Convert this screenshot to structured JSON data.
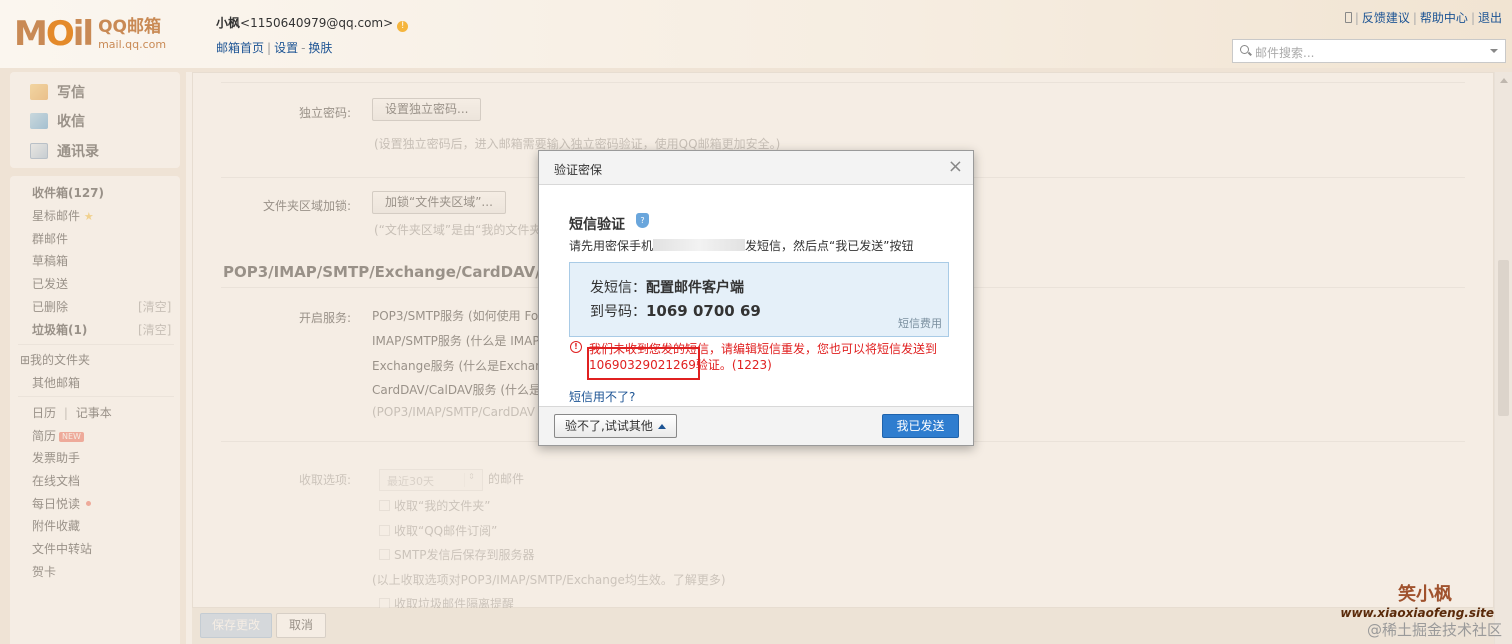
{
  "header": {
    "logo_mail": "M",
    "logo_o": "O",
    "logo_il": "il",
    "logo_cn": "QQ邮箱",
    "logo_url": "mail.qq.com",
    "user_name": "小枫",
    "user_email": "<1150640979@qq.com>",
    "warn_glyph": "!",
    "link_home": "邮箱首页",
    "link_settings": "设置",
    "link_skin": "换肤",
    "link_sep1": "|",
    "link_sep2": "-",
    "top_feedback": "反馈建议",
    "top_help": "帮助中心",
    "top_logout": "退出",
    "top_sep": "|",
    "search_placeholder": "邮件搜索..."
  },
  "sidebar": {
    "write": "写信",
    "receive": "收信",
    "contacts": "通讯录",
    "inbox": "收件箱(127)",
    "starred": "星标邮件",
    "star_glyph": "★",
    "group": "群邮件",
    "drafts": "草稿箱",
    "sent": "已发送",
    "deleted": "已删除",
    "clear": "[清空]",
    "spam": "垃圾箱(1)",
    "my_folders": "⊞我的文件夹",
    "other_mail": "其他邮箱",
    "calendar": "日历",
    "notes": "记事本",
    "cal_sep": "|",
    "resume": "简历",
    "new_badge": "NEW",
    "invoice": "发票助手",
    "docs": "在线文档",
    "daily": "每日悦读",
    "attachments": "附件收藏",
    "transfer": "文件中转站",
    "cards": "贺卡"
  },
  "settings": {
    "pwd_label": "独立密码:",
    "pwd_button": "设置独立密码...",
    "pwd_hint": "(设置独立密码后，进入邮箱需要输入独立密码验证，使用QQ邮箱更加安全。)",
    "folder_label": "文件夹区域加锁:",
    "folder_button": "加锁“文件夹区域”...",
    "folder_hint": "(“文件夹区域”是由“我的文件夹”",
    "section_title": "POP3/IMAP/SMTP/Exchange/CardDAV/",
    "service_label": "开启服务:",
    "svc_pop3": "POP3/SMTP服务 (如何使用 Fo",
    "svc_imap": "IMAP/SMTP服务 (什么是 IMAP",
    "svc_exchange": "Exchange服务 (什么是Exchan",
    "svc_carddav": "CardDAV/CalDAV服务 (什么是",
    "svc_hint": "(POP3/IMAP/SMTP/CardDAV",
    "recv_label": "收取选项:",
    "recv_select": "最近30天",
    "recv_select_arrow": "⇕",
    "recv_suffix": "的邮件",
    "opt1": "收取“我的文件夹”",
    "opt2": "收取“QQ邮件订阅”",
    "opt3": "SMTP发信后保存到服务器",
    "opt_note": "(以上收取选项对POP3/IMAP/SMTP/Exchange均生效。了解更多)",
    "opt4": "收取垃圾邮件隔离提醒",
    "save_button": "保存更改",
    "cancel_button": "取消"
  },
  "modal": {
    "title": "验证密保",
    "close_glyph": "×",
    "sms_title": "短信验证",
    "shield_glyph": "?",
    "desc_prefix": "请先用密保手机",
    "desc_suffix": "发短信，然后点“我已发送”按钮",
    "send_label": "发短信：",
    "send_content": "配置邮件客户端",
    "to_label": "到号码：",
    "to_number": "1069 0700 69",
    "fee": "短信费用",
    "err_glyph": "!",
    "error_text": "我们未收到您发的短信，请编辑短信重发，您也可以将短信发送到10690329021269验证。(1223)",
    "alt_link": "短信用不了?",
    "other_button": "验不了,试试其他",
    "sent_button": "我已发送"
  },
  "watermark": {
    "sig": "笑小枫",
    "url": "www.xiaoxiaofeng.site",
    "text": "@稀土掘金技术社区"
  },
  "colors": {
    "accent": "#2f7dcf",
    "error": "#e02020",
    "link": "#1d5494"
  }
}
